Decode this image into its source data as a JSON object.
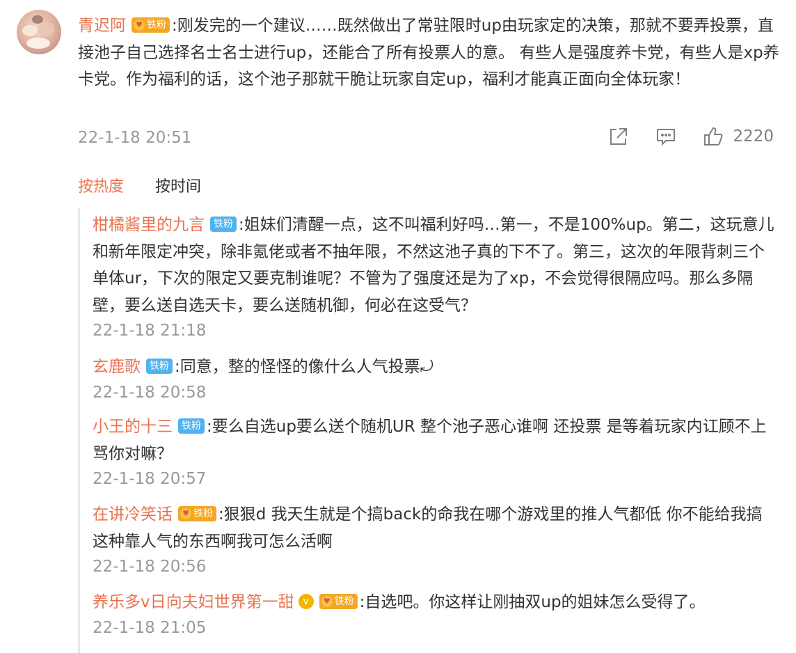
{
  "main_comment": {
    "username": "青迟阿",
    "badge": "铁粉",
    "text": ":刚发完的一个建议……既然做出了常驻限时up由玩家定的决策，那就不要弄投票，直接池子自己选择名士名士进行up，还能合了所有投票人的意。 有些人是强度养卡党，有些人是xp养卡党。作为福利的话，这个池子那就干脆让玩家自定up，福利才能真正面向全体玩家！",
    "time": "22-1-18 20:51",
    "like_count": "2220"
  },
  "sort_tabs": {
    "hot": "按热度",
    "time": "按时间"
  },
  "replies": [
    {
      "username": "柑橘酱里的九言",
      "badge": "铁粉",
      "badge_style": "blue",
      "text": ":姐妹们清醒一点，这不叫福利好吗…第一，不是100%up。第二，这玩意儿和新年限定冲突，除非氪佬或者不抽年限，不然这池子真的下不了。第三，这次的年限背刺三个单体ur，下次的限定又要克制谁呢？不管为了强度还是为了xp，不会觉得很隔应吗。那么多隔壁，要么送自选天卡，要么送随机御，何必在这受气？",
      "time": "22-1-18 21:18"
    },
    {
      "username": "玄鹿歌",
      "badge": "铁粉",
      "badge_style": "blue",
      "text": ":同意，整的怪怪的像什么人气投票⤾",
      "time": "22-1-18 20:58"
    },
    {
      "username": "小王的十三",
      "badge": "铁粉",
      "badge_style": "blue",
      "text": ":要么自选up要么送个随机UR  整个池子恶心谁啊  还投票 是等着玩家内讧顾不上骂你对嘛？",
      "time": "22-1-18 20:57"
    },
    {
      "username": "在讲冷笑话",
      "badge": "铁粉",
      "badge_style": "gold",
      "text": ":狠狠d  我天生就是个搞back的命我在哪个游戏里的推人气都低   你不能给我搞这种靠人气的东西啊我可怎么活啊",
      "time": "22-1-18 20:56"
    },
    {
      "username": "养乐多v日向夫妇世界第一甜",
      "badge": "铁粉",
      "badge_style": "gold",
      "verified": true,
      "text": ":自选吧。你这样让刚抽双up的姐妹怎么受得了。",
      "time": "22-1-18 21:05"
    }
  ],
  "colors": {
    "username": "#eb7350",
    "time": "#999999",
    "badge_blue": "#4fb3ef",
    "badge_gold": "#f5a623"
  },
  "icons": [
    "forward-icon",
    "comment-icon",
    "like-icon",
    "crown-icon",
    "verified-icon"
  ]
}
